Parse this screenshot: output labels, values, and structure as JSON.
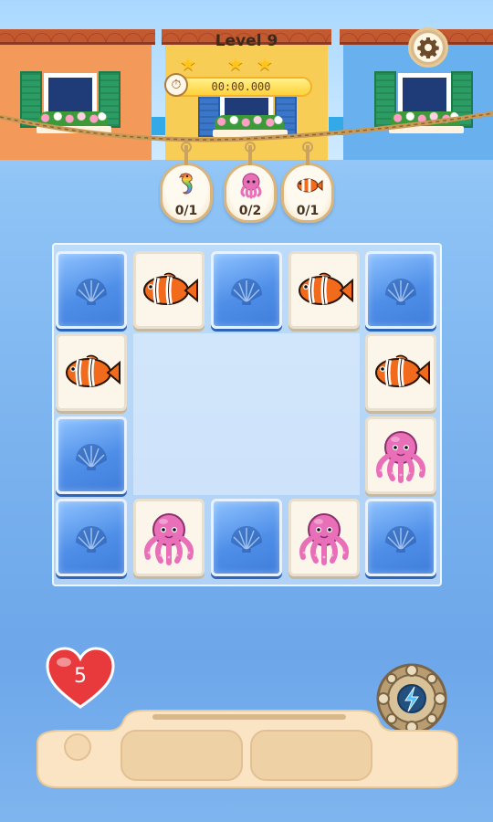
{
  "header": {
    "level_label": "Level 9",
    "stars_earned": 3,
    "timer": "00:00.000",
    "settings_icon": "gear-icon",
    "timer_icon": "stopwatch-icon"
  },
  "goals": [
    {
      "icon": "seahorse-icon",
      "count": "0/1"
    },
    {
      "icon": "octopus-icon",
      "count": "0/2"
    },
    {
      "icon": "clownfish-icon",
      "count": "0/1"
    }
  ],
  "board": {
    "tiles": [
      {
        "row": 0,
        "col": 0,
        "kind": "back",
        "icon": "shell-icon"
      },
      {
        "row": 0,
        "col": 1,
        "kind": "face",
        "icon": "clownfish-icon"
      },
      {
        "row": 0,
        "col": 2,
        "kind": "back",
        "icon": "shell-icon"
      },
      {
        "row": 0,
        "col": 3,
        "kind": "face",
        "icon": "clownfish-icon"
      },
      {
        "row": 0,
        "col": 4,
        "kind": "back",
        "icon": "shell-icon"
      },
      {
        "row": 1,
        "col": 0,
        "kind": "face",
        "icon": "clownfish-icon"
      },
      {
        "row": 1,
        "col": 4,
        "kind": "face",
        "icon": "clownfish-icon"
      },
      {
        "row": 2,
        "col": 0,
        "kind": "back",
        "icon": "shell-icon"
      },
      {
        "row": 2,
        "col": 4,
        "kind": "face",
        "icon": "octopus-icon"
      },
      {
        "row": 3,
        "col": 0,
        "kind": "back",
        "icon": "shell-icon"
      },
      {
        "row": 3,
        "col": 1,
        "kind": "face",
        "icon": "octopus-icon"
      },
      {
        "row": 3,
        "col": 2,
        "kind": "back",
        "icon": "shell-icon"
      },
      {
        "row": 3,
        "col": 3,
        "kind": "face",
        "icon": "octopus-icon"
      },
      {
        "row": 3,
        "col": 4,
        "kind": "back",
        "icon": "shell-icon"
      }
    ]
  },
  "lives": {
    "count": "5",
    "icon": "heart-icon"
  },
  "booster": {
    "icon": "lightning-icon"
  },
  "colors": {
    "tile_back": "#4f8fe8",
    "tile_face": "#fbf5ea",
    "heart": "#e8393c",
    "octopus": "#e86fb8",
    "clownfish": "#f26a1b"
  }
}
